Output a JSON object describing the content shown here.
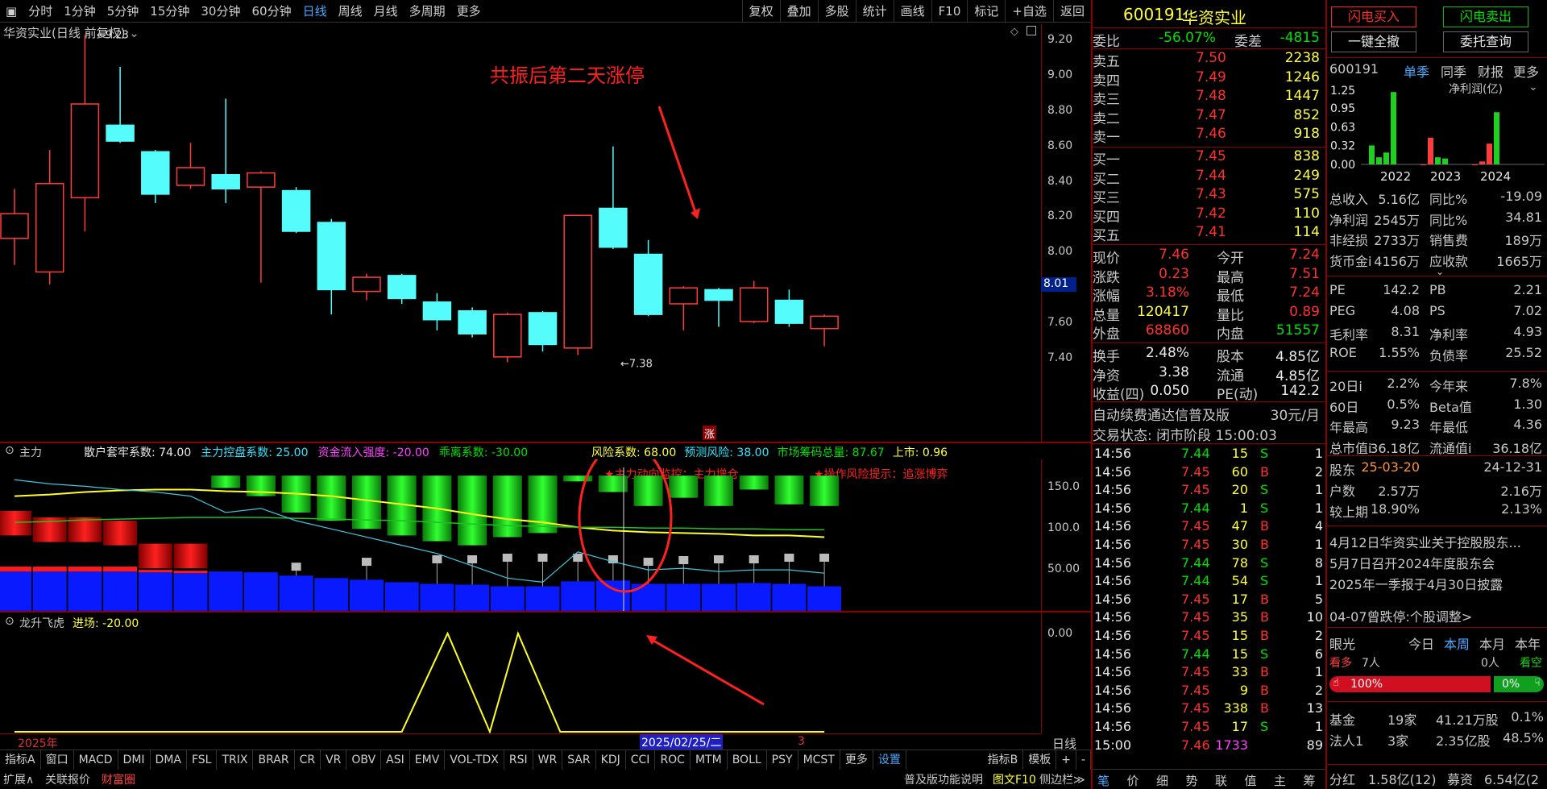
{
  "toolbar": {
    "periods": [
      "分时",
      "1分钟",
      "5分钟",
      "15分钟",
      "30分钟",
      "60分钟",
      "日线",
      "周线",
      "月线",
      "多周期",
      "更多"
    ],
    "selected": "日线",
    "right": [
      "复权",
      "叠加",
      "多股",
      "统计",
      "画线",
      "F10",
      "标记",
      "+自选",
      "返回"
    ]
  },
  "chart": {
    "title": "华资实业(日线 前复权)",
    "high_label": "9.23",
    "low_label": "7.38",
    "annotation": "共振后第二天涨停",
    "zhang_tag": "涨",
    "price_marker": "8.01",
    "y_ticks": [
      "9.20",
      "9.00",
      "8.80",
      "8.60",
      "8.40",
      "8.20",
      "8.00",
      "7.80",
      "7.60",
      "7.40"
    ],
    "candles": [
      {
        "o": 8.08,
        "c": 8.22,
        "h": 8.36,
        "l": 7.93
      },
      {
        "o": 7.89,
        "c": 8.39,
        "h": 8.58,
        "l": 7.82
      },
      {
        "o": 8.31,
        "c": 8.84,
        "h": 9.23,
        "l": 8.12
      },
      {
        "o": 8.72,
        "c": 8.63,
        "h": 9.05,
        "l": 8.62
      },
      {
        "o": 8.57,
        "c": 8.33,
        "h": 8.58,
        "l": 8.28
      },
      {
        "o": 8.38,
        "c": 8.48,
        "h": 8.62,
        "l": 8.36
      },
      {
        "o": 8.44,
        "c": 8.36,
        "h": 8.87,
        "l": 8.28
      },
      {
        "o": 8.37,
        "c": 8.45,
        "h": 8.46,
        "l": 7.83
      },
      {
        "o": 8.35,
        "c": 8.12,
        "h": 8.37,
        "l": 8.11
      },
      {
        "o": 8.17,
        "c": 7.79,
        "h": 8.19,
        "l": 7.65
      },
      {
        "o": 7.78,
        "c": 7.86,
        "h": 7.88,
        "l": 7.73
      },
      {
        "o": 7.87,
        "c": 7.74,
        "h": 7.88,
        "l": 7.71
      },
      {
        "o": 7.72,
        "c": 7.62,
        "h": 7.77,
        "l": 7.56
      },
      {
        "o": 7.67,
        "c": 7.54,
        "h": 7.69,
        "l": 7.52
      },
      {
        "o": 7.41,
        "c": 7.65,
        "h": 7.66,
        "l": 7.38
      },
      {
        "o": 7.66,
        "c": 7.48,
        "h": 7.67,
        "l": 7.44
      },
      {
        "o": 7.46,
        "c": 8.21,
        "h": 8.21,
        "l": 7.42
      },
      {
        "o": 8.25,
        "c": 8.03,
        "h": 8.6,
        "l": 8.02
      },
      {
        "o": 7.99,
        "c": 7.65,
        "h": 8.07,
        "l": 7.64
      },
      {
        "o": 7.71,
        "c": 7.8,
        "h": 7.81,
        "l": 7.56
      },
      {
        "o": 7.79,
        "c": 7.73,
        "h": 7.8,
        "l": 7.58
      },
      {
        "o": 7.61,
        "c": 7.8,
        "h": 7.84,
        "l": 7.6
      },
      {
        "o": 7.73,
        "c": 7.6,
        "h": 7.79,
        "l": 7.58
      },
      {
        "o": 7.57,
        "c": 7.64,
        "h": 7.65,
        "l": 7.47
      }
    ]
  },
  "zhuli": {
    "name": "主力",
    "items": [
      {
        "t": "散户套牢系数: 74.00",
        "c": "#e8e8e8"
      },
      {
        "t": "主力控盘系数: 25.00",
        "c": "#2ee6ff"
      },
      {
        "t": "资金流入强度: -20.00",
        "c": "#ff40ff"
      },
      {
        "t": "乖离系数: -30.00",
        "c": "#00e000"
      }
    ],
    "items2": [
      {
        "t": "风险系数: 68.00",
        "c": "#ffff40"
      },
      {
        "t": "预测风险: 38.00",
        "c": "#2ee6ff"
      },
      {
        "t": "市场筹码总量: 87.67",
        "c": "#00e000"
      },
      {
        "t": "上市: 0.96",
        "c": "#ffff40"
      }
    ],
    "note1": "★主力动向监控：主力增仓",
    "note2": "★操作风险提示：追涨博弈",
    "y_ticks": [
      "150.0",
      "100.0",
      "50.00"
    ]
  },
  "lsfh": {
    "name": "龙升飞虎",
    "value_label": "进场: -20.00",
    "y_tick": "0.00",
    "x_labels": [
      "2025年",
      "2025/02/25/二",
      "3"
    ],
    "axis_name": "日线"
  },
  "bottom_tabs": [
    "指标A",
    "窗口",
    "MACD",
    "DMI",
    "DMA",
    "FSL",
    "TRIX",
    "BRAR",
    "CR",
    "VR",
    "OBV",
    "ASI",
    "EMV",
    "VOL-TDX",
    "RSI",
    "WR",
    "SAR",
    "KDJ",
    "CCI",
    "ROC",
    "MTM",
    "BOLL",
    "PSY",
    "MCST",
    "更多",
    "设置"
  ],
  "bottom_right": [
    "指标B",
    "模板",
    "+",
    "-"
  ],
  "bottom2": {
    "left": [
      "扩展∧",
      "关联报价",
      "财富圈"
    ],
    "right": [
      "普及版功能说明",
      "图文F10",
      "侧边栏≫"
    ]
  },
  "quote": {
    "code": "600191",
    "name": "华资实业",
    "weibi": "-56.07%",
    "weicha": "-4815",
    "sells": [
      {
        "l": "卖五",
        "p": "7.50",
        "v": "2238"
      },
      {
        "l": "卖四",
        "p": "7.49",
        "v": "1246"
      },
      {
        "l": "卖三",
        "p": "7.48",
        "v": "1447"
      },
      {
        "l": "卖二",
        "p": "7.47",
        "v": "852"
      },
      {
        "l": "卖一",
        "p": "7.46",
        "v": "918"
      }
    ],
    "buys": [
      {
        "l": "买一",
        "p": "7.45",
        "v": "838"
      },
      {
        "l": "买二",
        "p": "7.44",
        "v": "249"
      },
      {
        "l": "买三",
        "p": "7.43",
        "v": "575"
      },
      {
        "l": "买四",
        "p": "7.42",
        "v": "110"
      },
      {
        "l": "买五",
        "p": "7.41",
        "v": "114"
      }
    ],
    "stats": [
      [
        "现价",
        "7.46",
        "今开",
        "7.24"
      ],
      [
        "涨跌",
        "0.23",
        "最高",
        "7.51"
      ],
      [
        "涨幅",
        "3.18%",
        "最低",
        "7.24"
      ],
      [
        "总量",
        "120417",
        "量比",
        "0.89"
      ],
      [
        "外盘",
        "68860",
        "内盘",
        "51557"
      ]
    ],
    "stats2": [
      [
        "换手",
        "2.48%",
        "股本",
        "4.85亿"
      ],
      [
        "净资",
        "3.38",
        "流通",
        "4.85亿"
      ],
      [
        "收益(四)",
        "0.050",
        "PE(动)",
        "142.2"
      ]
    ],
    "ad": "自动续费通达信普及版",
    "ad_price": "30元/月",
    "status": "交易状态: 闭市阶段 15:00:03"
  },
  "ticks": [
    [
      "14:56",
      "7.44",
      "15",
      "S",
      "1"
    ],
    [
      "14:56",
      "7.45",
      "60",
      "B",
      "2"
    ],
    [
      "14:56",
      "7.45",
      "20",
      "S",
      "1"
    ],
    [
      "14:56",
      "7.44",
      "1",
      "S",
      "1"
    ],
    [
      "14:56",
      "7.45",
      "47",
      "B",
      "4"
    ],
    [
      "14:56",
      "7.45",
      "30",
      "B",
      "1"
    ],
    [
      "14:56",
      "7.44",
      "78",
      "S",
      "8"
    ],
    [
      "14:56",
      "7.44",
      "54",
      "S",
      "1"
    ],
    [
      "14:56",
      "7.45",
      "17",
      "B",
      "5"
    ],
    [
      "14:56",
      "7.45",
      "35",
      "B",
      "10"
    ],
    [
      "14:56",
      "7.45",
      "15",
      "B",
      "2"
    ],
    [
      "14:56",
      "7.44",
      "15",
      "S",
      "6"
    ],
    [
      "14:56",
      "7.45",
      "33",
      "B",
      "1"
    ],
    [
      "14:56",
      "7.45",
      "9",
      "B",
      "2"
    ],
    [
      "14:56",
      "7.45",
      "338",
      "B",
      "13"
    ],
    [
      "14:56",
      "7.45",
      "17",
      "S",
      "1"
    ],
    [
      "15:00",
      "7.46",
      "1733",
      "",
      "89"
    ]
  ],
  "ticks_tabs": [
    "笔",
    "价",
    "细",
    "势",
    "联",
    "值",
    "主",
    "筹"
  ],
  "fin": {
    "btn_buy": "闪电买入",
    "btn_sell": "闪电卖出",
    "btn_cancel": "一键全撤",
    "btn_query": "委托查询",
    "code": "600191",
    "tabs": [
      "单季",
      "同季",
      "财报",
      "更多"
    ],
    "subtitle": "净利润(亿)",
    "y_ticks": [
      "1.25",
      "0.95",
      "0.63",
      "0.32",
      "0.00"
    ],
    "years": [
      "2022",
      "2023",
      "2024"
    ],
    "bars": [
      0.32,
      0.12,
      0.2,
      1.22,
      0.0,
      0.45,
      0.12,
      0.1,
      0.0,
      0.05,
      0.35,
      0.88
    ],
    "rows": [
      [
        "总收入",
        "5.16亿",
        "同比%",
        "-19.09"
      ],
      [
        "净利润",
        "2545万",
        "同比%",
        "34.81"
      ],
      [
        "非经损",
        "2733万",
        "销售费",
        "189万"
      ],
      [
        "货币金i",
        "4156万",
        "应收款",
        "1665万"
      ]
    ],
    "rows2": [
      [
        "PE",
        "142.2",
        "PB",
        "2.21"
      ],
      [
        "PEG",
        "4.08",
        "PS",
        "7.02"
      ],
      [
        "毛利率",
        "8.31",
        "净利率",
        "4.93"
      ],
      [
        "ROE",
        "1.55%",
        "负债率",
        "25.52"
      ]
    ],
    "rows3": [
      [
        "20日i",
        "2.2%",
        "今年来",
        "7.8%"
      ],
      [
        "60日",
        "0.5%",
        "Beta值",
        "1.30"
      ],
      [
        "年最高",
        "9.23",
        "年最低",
        "4.36"
      ],
      [
        "总市值i",
        "36.18亿",
        "流通值i",
        "36.18亿"
      ]
    ],
    "rows4": [
      [
        "股东",
        "25-03-20",
        "",
        "24-12-31"
      ],
      [
        "户数",
        "2.57万",
        "",
        "2.16万"
      ],
      [
        "较上期",
        "18.90%",
        "",
        "2.13%"
      ]
    ],
    "news": [
      "4月12日华资实业关于控股股东...",
      "5月7日召开2024年度股东会",
      "2025年一季报于4月30日披露"
    ],
    "news2": "04-07曾跌停:个股调整>",
    "eye": {
      "title": "眼光",
      "tabs": [
        "今日",
        "本周",
        "本月",
        "本年"
      ],
      "kanduo": "看多",
      "kanduo_n": "7人",
      "kankong_n": "0人",
      "kankong": "看空",
      "pct_l": "100%",
      "pct_r": "0%"
    },
    "jj": [
      [
        "基金",
        "19家",
        "41.21万股",
        "0.1%"
      ],
      [
        "法人1",
        "3家",
        "2.35亿股",
        "48.5%"
      ]
    ],
    "bottom": [
      "分红",
      "1.58亿(12)",
      "募资",
      "6.54亿(2"
    ]
  }
}
